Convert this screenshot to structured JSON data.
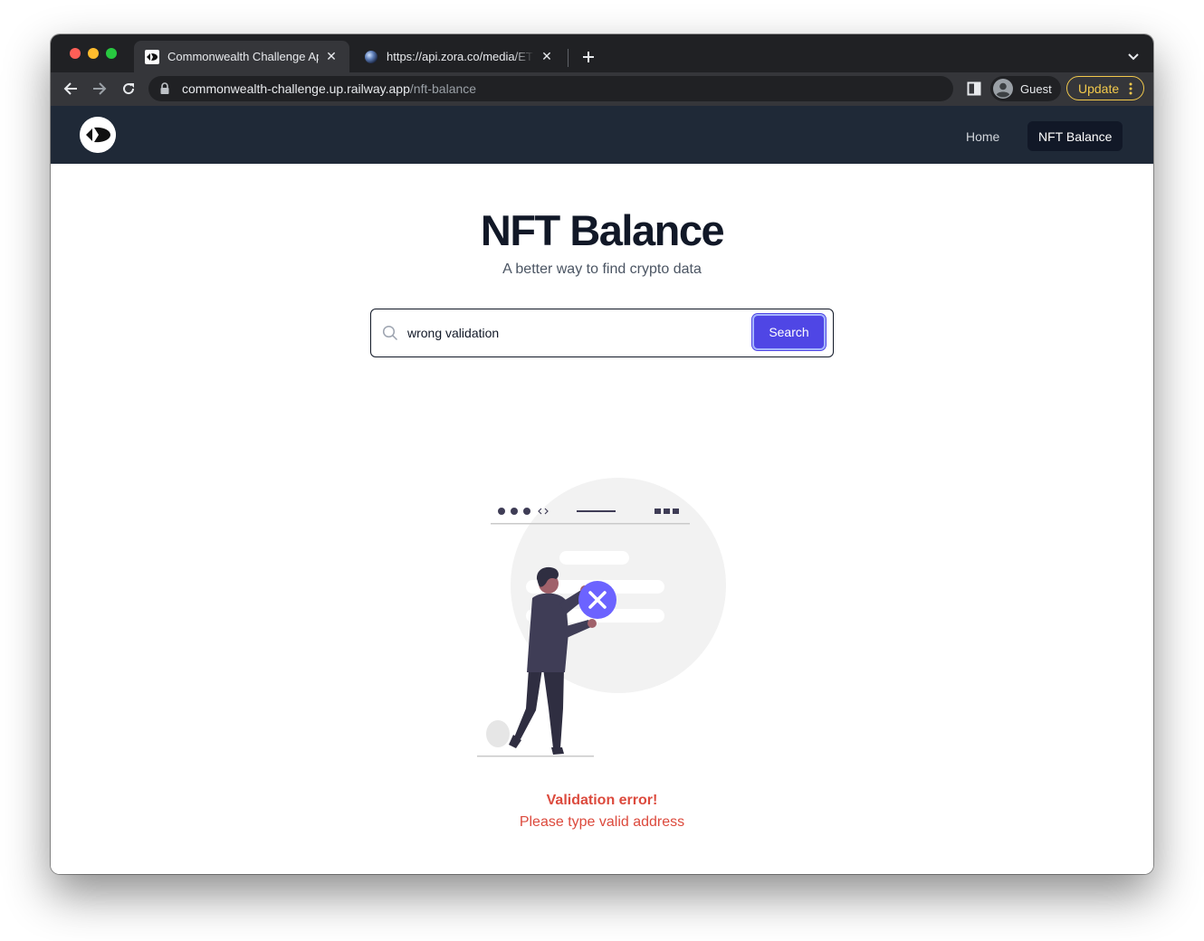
{
  "browser": {
    "tabs": [
      {
        "title": "Commonwealth Challenge App",
        "active": true
      },
      {
        "title": "https://api.zora.co/media/ETHEREUM",
        "active": false
      }
    ],
    "url_host": "commonwealth-challenge.up.railway.app",
    "url_path": "/nft-balance",
    "profile_label": "Guest",
    "update_label": "Update"
  },
  "nav": {
    "items": [
      {
        "label": "Home",
        "active": false
      },
      {
        "label": "NFT Balance",
        "active": true
      }
    ]
  },
  "page": {
    "title": "NFT Balance",
    "subtitle": "A better way to find crypto data"
  },
  "search": {
    "value": "wrong validation",
    "button_label": "Search"
  },
  "error": {
    "title": "Validation error!",
    "message": "Please type valid address"
  },
  "colors": {
    "accent": "#4f46e5",
    "header_bg": "#1f2937",
    "error": "#dc4a3d"
  }
}
